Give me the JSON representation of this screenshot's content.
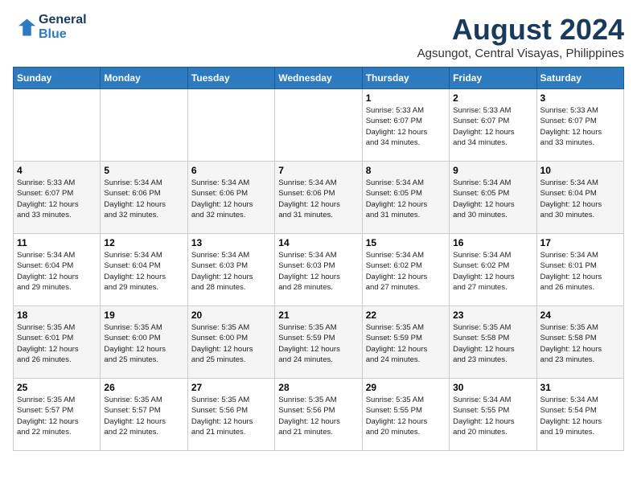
{
  "logo": {
    "line1": "General",
    "line2": "Blue"
  },
  "title": "August 2024",
  "subtitle": "Agsungot, Central Visayas, Philippines",
  "days_of_week": [
    "Sunday",
    "Monday",
    "Tuesday",
    "Wednesday",
    "Thursday",
    "Friday",
    "Saturday"
  ],
  "weeks": [
    [
      {
        "day": "",
        "info": ""
      },
      {
        "day": "",
        "info": ""
      },
      {
        "day": "",
        "info": ""
      },
      {
        "day": "",
        "info": ""
      },
      {
        "day": "1",
        "info": "Sunrise: 5:33 AM\nSunset: 6:07 PM\nDaylight: 12 hours\nand 34 minutes."
      },
      {
        "day": "2",
        "info": "Sunrise: 5:33 AM\nSunset: 6:07 PM\nDaylight: 12 hours\nand 34 minutes."
      },
      {
        "day": "3",
        "info": "Sunrise: 5:33 AM\nSunset: 6:07 PM\nDaylight: 12 hours\nand 33 minutes."
      }
    ],
    [
      {
        "day": "4",
        "info": "Sunrise: 5:33 AM\nSunset: 6:07 PM\nDaylight: 12 hours\nand 33 minutes."
      },
      {
        "day": "5",
        "info": "Sunrise: 5:34 AM\nSunset: 6:06 PM\nDaylight: 12 hours\nand 32 minutes."
      },
      {
        "day": "6",
        "info": "Sunrise: 5:34 AM\nSunset: 6:06 PM\nDaylight: 12 hours\nand 32 minutes."
      },
      {
        "day": "7",
        "info": "Sunrise: 5:34 AM\nSunset: 6:06 PM\nDaylight: 12 hours\nand 31 minutes."
      },
      {
        "day": "8",
        "info": "Sunrise: 5:34 AM\nSunset: 6:05 PM\nDaylight: 12 hours\nand 31 minutes."
      },
      {
        "day": "9",
        "info": "Sunrise: 5:34 AM\nSunset: 6:05 PM\nDaylight: 12 hours\nand 30 minutes."
      },
      {
        "day": "10",
        "info": "Sunrise: 5:34 AM\nSunset: 6:04 PM\nDaylight: 12 hours\nand 30 minutes."
      }
    ],
    [
      {
        "day": "11",
        "info": "Sunrise: 5:34 AM\nSunset: 6:04 PM\nDaylight: 12 hours\nand 29 minutes."
      },
      {
        "day": "12",
        "info": "Sunrise: 5:34 AM\nSunset: 6:04 PM\nDaylight: 12 hours\nand 29 minutes."
      },
      {
        "day": "13",
        "info": "Sunrise: 5:34 AM\nSunset: 6:03 PM\nDaylight: 12 hours\nand 28 minutes."
      },
      {
        "day": "14",
        "info": "Sunrise: 5:34 AM\nSunset: 6:03 PM\nDaylight: 12 hours\nand 28 minutes."
      },
      {
        "day": "15",
        "info": "Sunrise: 5:34 AM\nSunset: 6:02 PM\nDaylight: 12 hours\nand 27 minutes."
      },
      {
        "day": "16",
        "info": "Sunrise: 5:34 AM\nSunset: 6:02 PM\nDaylight: 12 hours\nand 27 minutes."
      },
      {
        "day": "17",
        "info": "Sunrise: 5:34 AM\nSunset: 6:01 PM\nDaylight: 12 hours\nand 26 minutes."
      }
    ],
    [
      {
        "day": "18",
        "info": "Sunrise: 5:35 AM\nSunset: 6:01 PM\nDaylight: 12 hours\nand 26 minutes."
      },
      {
        "day": "19",
        "info": "Sunrise: 5:35 AM\nSunset: 6:00 PM\nDaylight: 12 hours\nand 25 minutes."
      },
      {
        "day": "20",
        "info": "Sunrise: 5:35 AM\nSunset: 6:00 PM\nDaylight: 12 hours\nand 25 minutes."
      },
      {
        "day": "21",
        "info": "Sunrise: 5:35 AM\nSunset: 5:59 PM\nDaylight: 12 hours\nand 24 minutes."
      },
      {
        "day": "22",
        "info": "Sunrise: 5:35 AM\nSunset: 5:59 PM\nDaylight: 12 hours\nand 24 minutes."
      },
      {
        "day": "23",
        "info": "Sunrise: 5:35 AM\nSunset: 5:58 PM\nDaylight: 12 hours\nand 23 minutes."
      },
      {
        "day": "24",
        "info": "Sunrise: 5:35 AM\nSunset: 5:58 PM\nDaylight: 12 hours\nand 23 minutes."
      }
    ],
    [
      {
        "day": "25",
        "info": "Sunrise: 5:35 AM\nSunset: 5:57 PM\nDaylight: 12 hours\nand 22 minutes."
      },
      {
        "day": "26",
        "info": "Sunrise: 5:35 AM\nSunset: 5:57 PM\nDaylight: 12 hours\nand 22 minutes."
      },
      {
        "day": "27",
        "info": "Sunrise: 5:35 AM\nSunset: 5:56 PM\nDaylight: 12 hours\nand 21 minutes."
      },
      {
        "day": "28",
        "info": "Sunrise: 5:35 AM\nSunset: 5:56 PM\nDaylight: 12 hours\nand 21 minutes."
      },
      {
        "day": "29",
        "info": "Sunrise: 5:35 AM\nSunset: 5:55 PM\nDaylight: 12 hours\nand 20 minutes."
      },
      {
        "day": "30",
        "info": "Sunrise: 5:34 AM\nSunset: 5:55 PM\nDaylight: 12 hours\nand 20 minutes."
      },
      {
        "day": "31",
        "info": "Sunrise: 5:34 AM\nSunset: 5:54 PM\nDaylight: 12 hours\nand 19 minutes."
      }
    ]
  ]
}
